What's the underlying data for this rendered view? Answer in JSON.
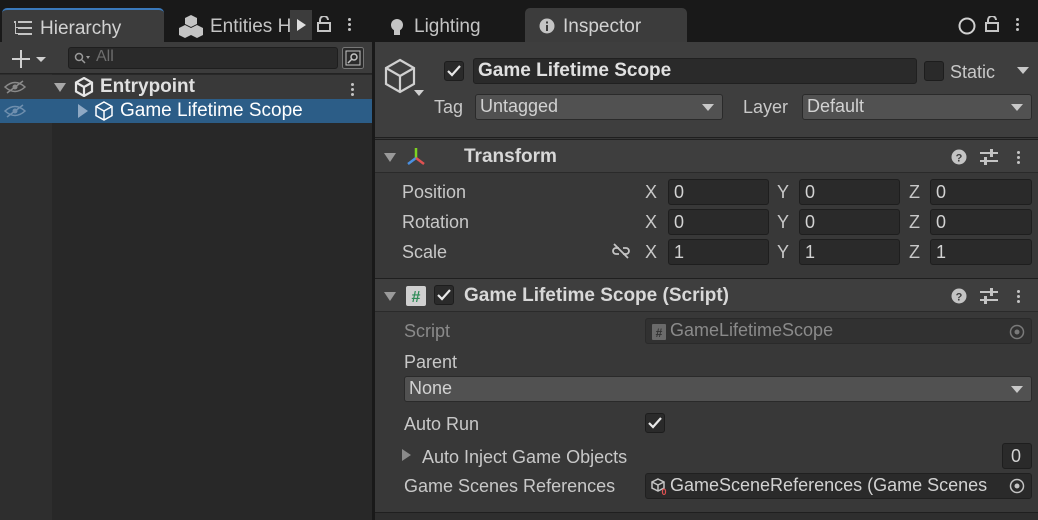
{
  "hierarchy": {
    "tab_label": "Hierarchy",
    "entities_tab_label": "Entities H",
    "search_placeholder": "All",
    "items": [
      {
        "label": "Entrypoint"
      },
      {
        "label": "Game Lifetime Scope"
      }
    ]
  },
  "tabs": {
    "lighting": "Lighting",
    "inspector": "Inspector"
  },
  "inspector": {
    "object_name": "Game Lifetime Scope",
    "static_label": "Static",
    "tag_label": "Tag",
    "tag_value": "Untagged",
    "layer_label": "Layer",
    "layer_value": "Default",
    "transform": {
      "title": "Transform",
      "rows": [
        {
          "label": "Position",
          "x": "0",
          "y": "0",
          "z": "0"
        },
        {
          "label": "Rotation",
          "x": "0",
          "y": "0",
          "z": "0"
        },
        {
          "label": "Scale",
          "x": "1",
          "y": "1",
          "z": "1"
        }
      ],
      "axis_x": "X",
      "axis_y": "Y",
      "axis_z": "Z"
    },
    "script_component": {
      "title": "Game Lifetime Scope (Script)",
      "script_label": "Script",
      "script_value": "GameLifetimeScope",
      "parent_label": "Parent",
      "parent_value": "None",
      "auto_run_label": "Auto Run",
      "auto_inject_label": "Auto Inject Game Objects",
      "auto_inject_count": "0",
      "scene_refs_label": "Game Scenes References",
      "scene_refs_value": "GameSceneReferences (Game Scenes"
    }
  },
  "colors": {
    "selection": "#2c5d87",
    "tab_accent": "#3a79bb",
    "panel_bg": "#383838"
  }
}
